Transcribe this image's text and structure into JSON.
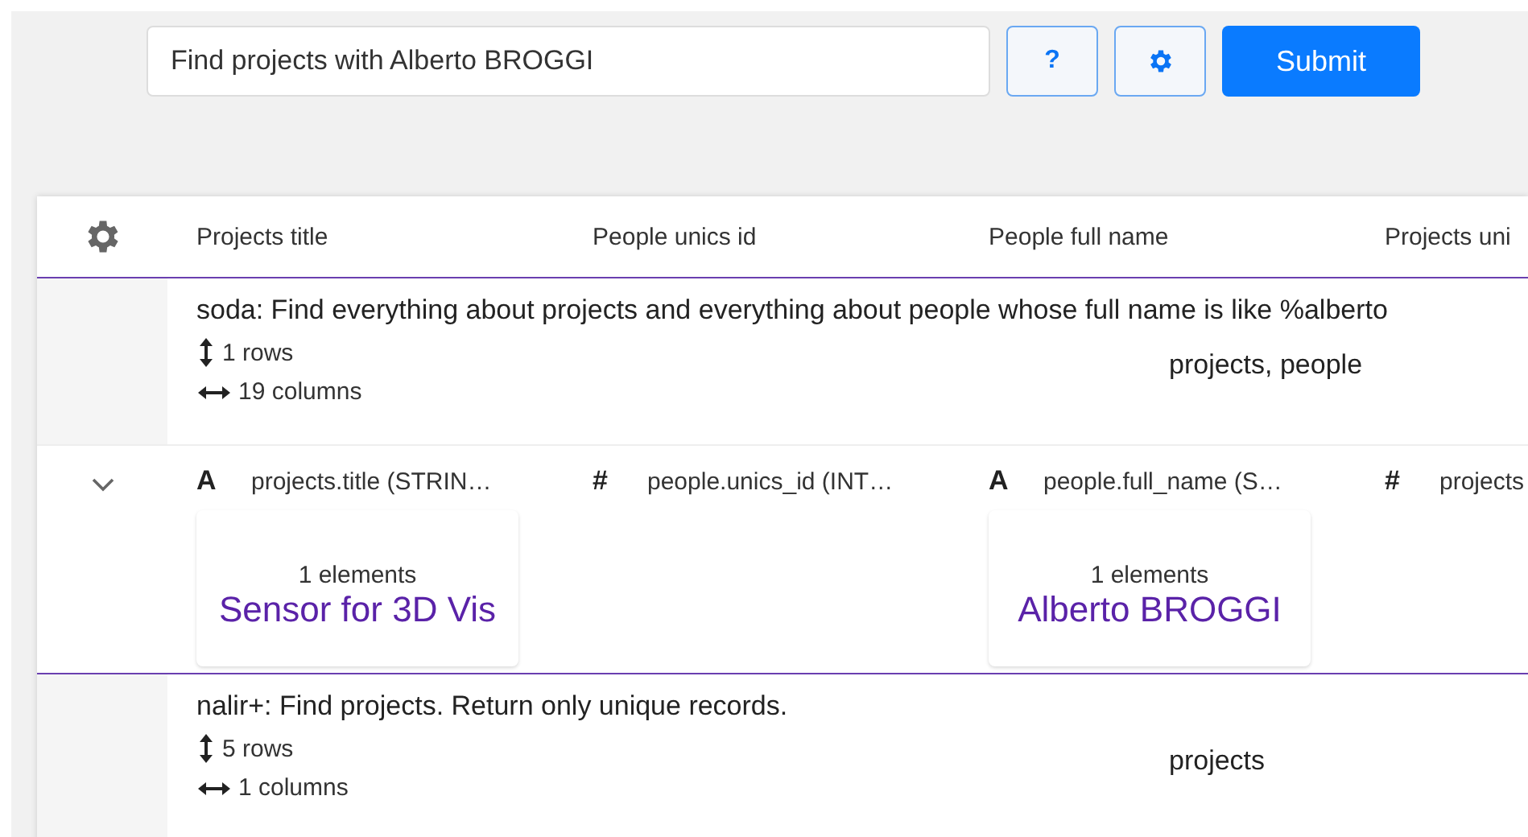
{
  "search": {
    "value": "Find projects with Alberto BROGGI"
  },
  "toolbar": {
    "help_label": "?",
    "submit_label": "Submit"
  },
  "table": {
    "columns": [
      "Projects title",
      "People unics id",
      "People full name",
      "Projects uni"
    ],
    "results": [
      {
        "kind": "summary",
        "description": "soda: Find everything about projects and everything about people whose full name is like %alberto",
        "rows": "1 rows",
        "columns": "19 columns",
        "tables": "projects, people"
      },
      {
        "kind": "detail",
        "expanded": true,
        "fields": [
          {
            "type": "A",
            "label": "projects.title (STRIN…",
            "count": "1 elements",
            "value": "Sensor for 3D Vis"
          },
          {
            "type": "#",
            "label": "people.unics_id (INT…"
          },
          {
            "type": "A",
            "label": "people.full_name (S…",
            "count": "1 elements",
            "value": "Alberto BROGGI"
          },
          {
            "type": "#",
            "label": "projects"
          }
        ]
      },
      {
        "kind": "summary",
        "description": "nalir+: Find projects. Return only unique records.",
        "rows": "5 rows",
        "columns": "1 columns",
        "tables": "projects"
      }
    ]
  }
}
